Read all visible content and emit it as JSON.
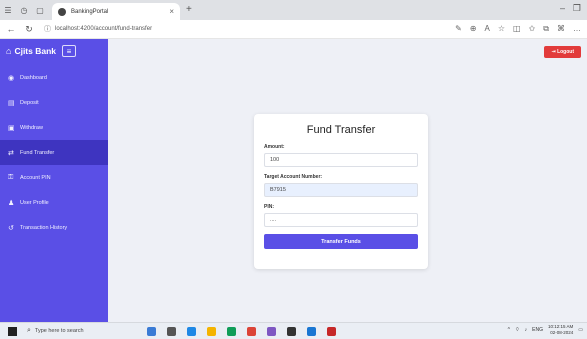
{
  "browser": {
    "tab_title": "BankingPortal",
    "url": "localhost:4200/account/fund-transfer"
  },
  "sidebar": {
    "brand": "Cjits Bank",
    "items": [
      {
        "label": "Dashboard",
        "icon": "dashboard-icon"
      },
      {
        "label": "Deposit",
        "icon": "deposit-icon"
      },
      {
        "label": "Withdraw",
        "icon": "withdraw-icon"
      },
      {
        "label": "Fund Transfer",
        "icon": "transfer-icon",
        "active": true
      },
      {
        "label": "Account PIN",
        "icon": "key-icon"
      },
      {
        "label": "User Profile",
        "icon": "user-icon"
      },
      {
        "label": "Transaction History",
        "icon": "history-icon"
      }
    ]
  },
  "topbar": {
    "logout_label": "Logout"
  },
  "form": {
    "title": "Fund Transfer",
    "amount_label": "Amount:",
    "amount_value": "100",
    "target_label": "Target Account Number:",
    "target_value": "B7915",
    "pin_label": "PIN:",
    "pin_value": "....",
    "submit_label": "Transfer Funds"
  },
  "taskbar": {
    "search_placeholder": "Type here to search",
    "time": "10:12:15 AM",
    "date": "02-08-2024",
    "lang": "ENG"
  },
  "colors": {
    "sidebar": "#5a4fe6",
    "active": "#3e34c0",
    "logout": "#e23b3b",
    "primary": "#5a4fe6"
  }
}
